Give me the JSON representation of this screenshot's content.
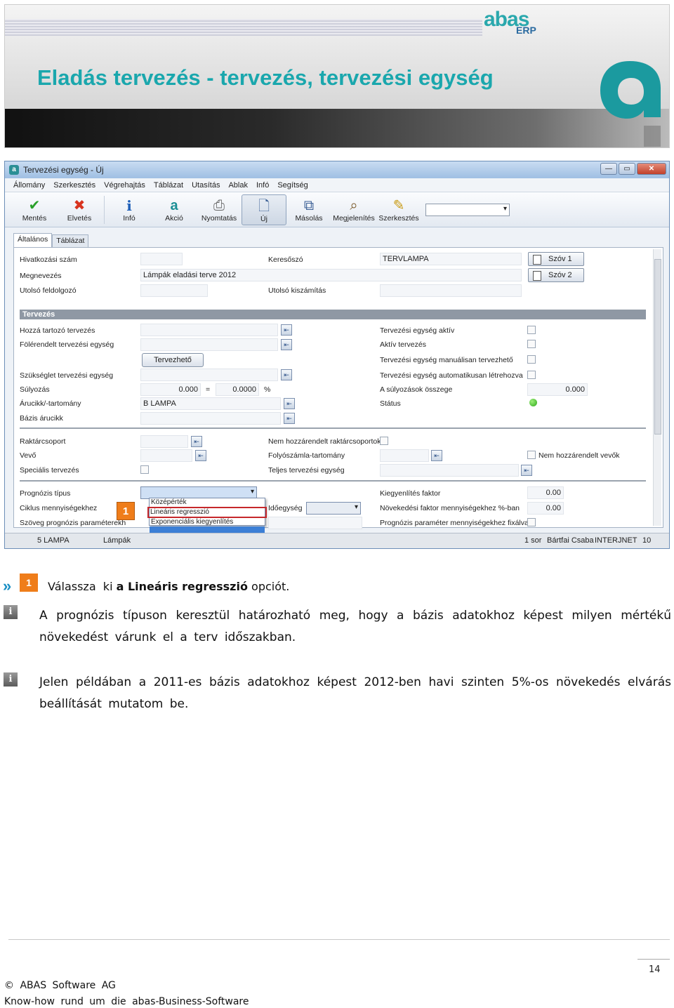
{
  "banner": {
    "title": "Eladás tervezés - tervezés, tervezési egység",
    "brand": "abas",
    "brand_sub": "ERP"
  },
  "window": {
    "title": "Tervezési egység - Új",
    "menu": [
      "Állomány",
      "Szerkesztés",
      "Végrehajtás",
      "Táblázat",
      "Utasítás",
      "Ablak",
      "Infó",
      "Segítség"
    ],
    "toolbar": {
      "save": "Mentés",
      "discard": "Elvetés",
      "info": "Infó",
      "action": "Akció",
      "print": "Nyomtatás",
      "new": "Új",
      "copy": "Másolás",
      "display": "Megjelenítés",
      "edit": "Szerkesztés"
    },
    "tabs": [
      "Általános",
      "Táblázat"
    ],
    "fields": {
      "ref_number": "Hivatkozási szám",
      "keyword": "Keresőszó",
      "keyword_value": "TERVLAMPA",
      "name": "Megnevezés",
      "name_value": "Lámpák eladási terve 2012",
      "last_processor": "Utolsó feldolgozó",
      "last_calc": "Utolsó kiszámítás",
      "szo1": "Szóv 1",
      "szo2": "Szóv 2",
      "section_planning": "Tervezés",
      "related_plans": "Hozzá tartozó tervezés",
      "parent_unit": "Fölérendelt tervezési egység",
      "plannable_btn": "Tervezhető",
      "demand_unit": "Szükséglet tervezési egység",
      "weighting": "Súlyozás",
      "weight_value": "0.000",
      "weight_eq": "=",
      "weight_pct": "0.0000",
      "weight_pct_sign": "%",
      "article_range": "Árucikk/-tartomány",
      "article_value": "B LAMPA",
      "base_article": "Bázis árucikk",
      "unit_active": "Tervezési egység aktív",
      "active_planning": "Aktív tervezés",
      "manual_unit": "Tervezési egység manuálisan tervezhető",
      "auto_unit": "Tervezési egység automatikusan létrehozva",
      "weights_sum": "A súlyozások összege",
      "weights_sum_value": "0.000",
      "status": "Státus",
      "warehouse_group": "Raktárcsoport",
      "customer": "Vevő",
      "special_planning": "Speciális tervezés",
      "unassigned_wh": "Nem hozzárendelt raktárcsoportok",
      "account_range": "Folyószámla-tartomány",
      "full_unit": "Teljes tervezési egység",
      "unassigned_customers": "Nem hozzárendelt vevők",
      "forecast_type": "Prognózis típus",
      "cycle_qty": "Ciklus mennyiségekhez",
      "text_params": "Szöveg prognózis paraméterekh",
      "time_unit": "Időegység",
      "smoothing": "Kiegyenlítés faktor",
      "smoothing_value": "0.00",
      "growth": "Növekedési faktor mennyiségekhez %-ban",
      "growth_value": "0.00",
      "fixed_params": "Prognózis paraméter mennyiségekhez fixálva"
    },
    "dropdown": {
      "options": [
        "Középérték",
        "Lineáris regresszió",
        "Exponenciális kiegyenlítés"
      ],
      "selected": "Lineáris regresszió"
    },
    "step_marker": "1",
    "statusbar": {
      "left1": "5 LAMPA",
      "left2": "Lámpák",
      "rows": "1 sor",
      "user": "Bártfai Csaba",
      "server": "INTERJNET",
      "num": "10"
    }
  },
  "instruction": {
    "step": "1",
    "before": "Válassza  ki ",
    "bold": "a Lineáris regresszió",
    "after": " opciót."
  },
  "info1": "A prognózis típuson keresztül határozható meg, hogy a bázis adatokhoz képest milyen mértékű növekedést várunk el a terv időszakban.",
  "info2": "Jelen példában a 2011-es bázis adatokhoz képest 2012-ben havi szinten 5%-os növekedés elvárás beállítását mutatom be.",
  "footer": {
    "page": "14",
    "copyright": "© ABAS Software AG",
    "tagline": "Know-how rund um die abas-Business-Software"
  },
  "colors": {
    "accent_teal": "#1aa7ad",
    "marker_orange": "#ef7d1a",
    "selection_red": "#c6282b",
    "status_green": "#2ea71a"
  }
}
